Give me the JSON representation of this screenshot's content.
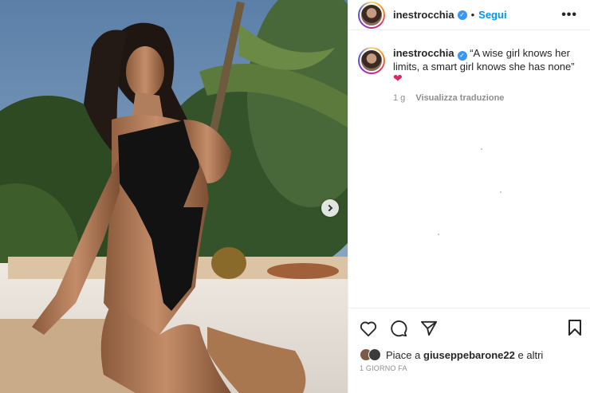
{
  "post": {
    "username": "inestrocchia",
    "follow_label": "Segui",
    "dot": "•",
    "more": "•••",
    "caption": "“A wise girl knows her limits, a smart girl knows she has none”",
    "caption_heart": "❤",
    "time_ago": "1 g",
    "translate_label": "Visualizza traduzione",
    "likes_prefix": "Piace a",
    "likes_user": "giuseppebarone22",
    "likes_suffix": "e altri",
    "date": "1 GIORNO FA"
  },
  "icons": {
    "verified": "verified-badge",
    "like": "heart-icon",
    "comment": "comment-icon",
    "share": "send-icon",
    "save": "bookmark-icon",
    "next": "chevron-right-icon"
  },
  "colors": {
    "link": "#0095f6",
    "verified": "#3897f0",
    "heart": "#e0245e",
    "muted": "#8e8e8e"
  }
}
